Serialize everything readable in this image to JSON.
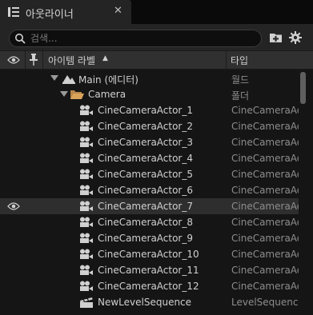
{
  "tab": {
    "title": "아웃라이너",
    "close": "✕",
    "icon": "outliner-list-icon"
  },
  "search": {
    "placeholder": "검색...",
    "value": ""
  },
  "toolbar": {
    "add_icon": "add-folder-icon",
    "settings_icon": "gear-icon"
  },
  "columns": {
    "visibility_icon": "eye-icon",
    "pin_icon": "pin-icon",
    "label": "아이템 라벨",
    "sort_indicator": "▲",
    "type": "타입"
  },
  "colors": {
    "background": "#151515",
    "panel": "#242424",
    "header": "#303030",
    "highlight_row": "#2e2e2e",
    "folder": "#d9a45a"
  },
  "rows": [
    {
      "name": "Main (에디터)",
      "type": "월드",
      "icon": "world-icon",
      "expanded": true,
      "visible": false
    },
    {
      "name": "Camera",
      "type": "폴더",
      "icon": "folder-icon",
      "expanded": true,
      "visible": false
    },
    {
      "name": "CineCameraActor_1",
      "type": "CineCameraActor",
      "icon": "cine-camera-icon",
      "visible": false
    },
    {
      "name": "CineCameraActor_2",
      "type": "CineCameraActor",
      "icon": "cine-camera-icon",
      "visible": false
    },
    {
      "name": "CineCameraActor_3",
      "type": "CineCameraActor",
      "icon": "cine-camera-icon",
      "visible": false
    },
    {
      "name": "CineCameraActor_4",
      "type": "CineCameraActor",
      "icon": "cine-camera-icon",
      "visible": false
    },
    {
      "name": "CineCameraActor_5",
      "type": "CineCameraActor",
      "icon": "cine-camera-icon",
      "visible": false
    },
    {
      "name": "CineCameraActor_6",
      "type": "CineCameraActor",
      "icon": "cine-camera-icon",
      "visible": false
    },
    {
      "name": "CineCameraActor_7",
      "type": "CineCameraActor",
      "icon": "cine-camera-icon",
      "visible": true
    },
    {
      "name": "CineCameraActor_8",
      "type": "CineCameraActor",
      "icon": "cine-camera-icon",
      "visible": false
    },
    {
      "name": "CineCameraActor_9",
      "type": "CineCameraActor",
      "icon": "cine-camera-icon",
      "visible": false
    },
    {
      "name": "CineCameraActor_10",
      "type": "CineCameraActor",
      "icon": "cine-camera-icon",
      "visible": false
    },
    {
      "name": "CineCameraActor_11",
      "type": "CineCameraActor",
      "icon": "cine-camera-icon",
      "visible": false
    },
    {
      "name": "CineCameraActor_12",
      "type": "CineCameraActor",
      "icon": "cine-camera-icon",
      "visible": false
    },
    {
      "name": "NewLevelSequence",
      "type": "LevelSequence",
      "icon": "level-sequence-icon",
      "visible": false
    }
  ]
}
